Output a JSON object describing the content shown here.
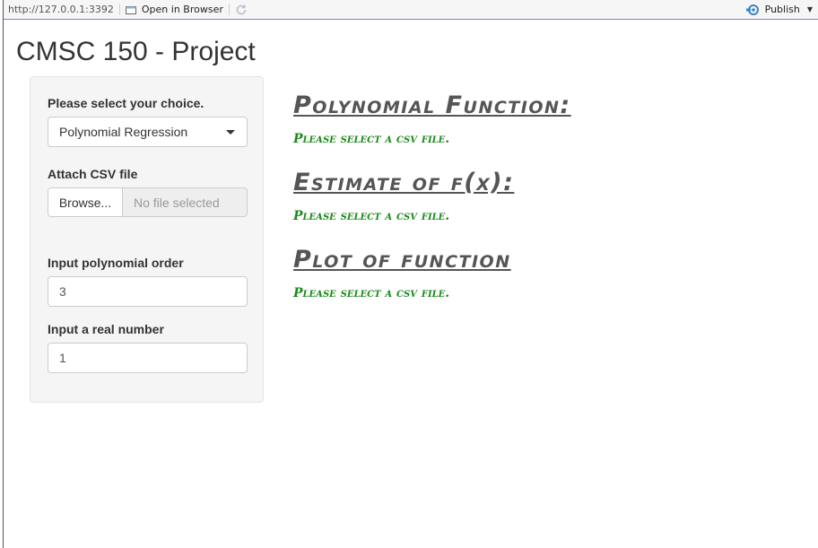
{
  "toolbar": {
    "url": "http://127.0.0.1:3392",
    "open_label": "Open in Browser",
    "publish_label": "Publish"
  },
  "page": {
    "title": "CMSC 150 - Project"
  },
  "sidebar": {
    "choice_label": "Please select your choice.",
    "choice_value": "Polynomial Regression",
    "csv_label": "Attach CSV file",
    "browse_label": "Browse...",
    "file_status": "No file selected",
    "order_label": "Input polynomial order",
    "order_value": "3",
    "real_label": "Input a real number",
    "real_value": "1"
  },
  "main": {
    "sections": [
      {
        "heading": "Polynomial Function:",
        "message": "Please select a csv file."
      },
      {
        "heading": "Estimate of f(x):",
        "message": "Please select a csv file."
      },
      {
        "heading": "Plot of function",
        "message": "Please select a csv file."
      }
    ]
  },
  "colors": {
    "message_green": "#1a8a1a",
    "heading_gray": "#555555",
    "toolbar_border": "#6d8ec6"
  },
  "icons": [
    "open-in-browser-icon",
    "refresh-icon",
    "publish-icon",
    "chevron-down-icon"
  ]
}
